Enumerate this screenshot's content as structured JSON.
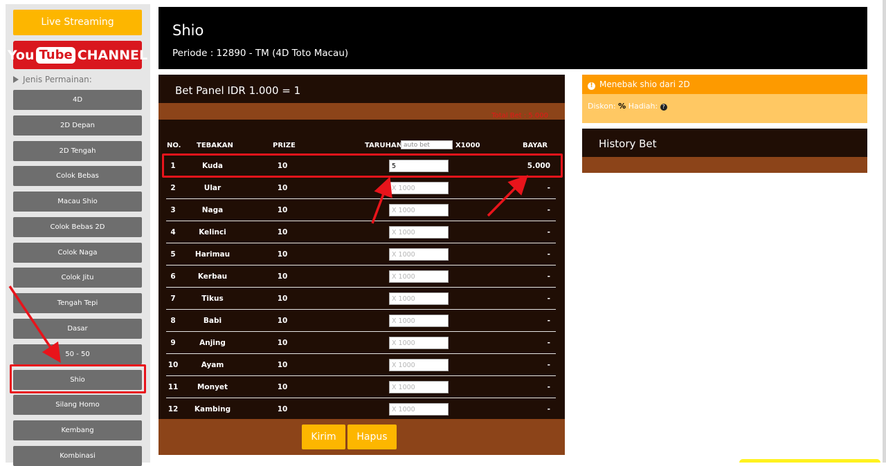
{
  "sidebar": {
    "live_label": "Live Streaming",
    "youtube_left": "You",
    "youtube_tube": "Tube",
    "youtube_channel": "CHANNEL",
    "jenis_label": "Jenis Permainan:",
    "items": [
      {
        "label": "4D"
      },
      {
        "label": "2D Depan"
      },
      {
        "label": "2D Tengah"
      },
      {
        "label": "Colok Bebas"
      },
      {
        "label": "Macau Shio"
      },
      {
        "label": "Colok Bebas 2D"
      },
      {
        "label": "Colok Naga"
      },
      {
        "label": "Colok Jitu"
      },
      {
        "label": "Tengah Tepi"
      },
      {
        "label": "Dasar"
      },
      {
        "label": "50 - 50"
      },
      {
        "label": "Shio",
        "active": true
      },
      {
        "label": "Silang Homo"
      },
      {
        "label": "Kembang"
      },
      {
        "label": "Kombinasi"
      }
    ]
  },
  "header": {
    "title": "Shio",
    "periode": "Periode : 12890 - TM (4D Toto Macau)"
  },
  "bet_panel": {
    "title": "Bet Panel IDR 1.000 = 1",
    "total_bet": "Total Bet : 5.000",
    "columns": {
      "no": "NO.",
      "tebakan": "TEBAKAN",
      "prize": "PRIZE",
      "taruhan": "TARUHAN",
      "autobet_placeholder": "auto bet",
      "x1000": "X1000",
      "bayar": "BAYAR"
    },
    "input_placeholder": "X 1000",
    "rows": [
      {
        "no": "1",
        "tebakan": "Kuda",
        "prize": "10",
        "taruhan": "5",
        "bayar": "5.000"
      },
      {
        "no": "2",
        "tebakan": "Ular",
        "prize": "10",
        "taruhan": "",
        "bayar": "-"
      },
      {
        "no": "3",
        "tebakan": "Naga",
        "prize": "10",
        "taruhan": "",
        "bayar": "-"
      },
      {
        "no": "4",
        "tebakan": "Kelinci",
        "prize": "10",
        "taruhan": "",
        "bayar": "-"
      },
      {
        "no": "5",
        "tebakan": "Harimau",
        "prize": "10",
        "taruhan": "",
        "bayar": "-"
      },
      {
        "no": "6",
        "tebakan": "Kerbau",
        "prize": "10",
        "taruhan": "",
        "bayar": "-"
      },
      {
        "no": "7",
        "tebakan": "Tikus",
        "prize": "10",
        "taruhan": "",
        "bayar": "-"
      },
      {
        "no": "8",
        "tebakan": "Babi",
        "prize": "10",
        "taruhan": "",
        "bayar": "-"
      },
      {
        "no": "9",
        "tebakan": "Anjing",
        "prize": "10",
        "taruhan": "",
        "bayar": "-"
      },
      {
        "no": "10",
        "tebakan": "Ayam",
        "prize": "10",
        "taruhan": "",
        "bayar": "-"
      },
      {
        "no": "11",
        "tebakan": "Monyet",
        "prize": "10",
        "taruhan": "",
        "bayar": "-"
      },
      {
        "no": "12",
        "tebakan": "Kambing",
        "prize": "10",
        "taruhan": "",
        "bayar": "-"
      }
    ],
    "kirim_label": "Kirim",
    "hapus_label": "Hapus"
  },
  "info": {
    "title": "Menebak shio dari 2D",
    "diskon_label": "Diskon:",
    "diskon_value": "%",
    "hadiah_label": "Hadiah:",
    "hadiah_icon": "?"
  },
  "history": {
    "title": "History Bet"
  },
  "colors": {
    "accent_yellow": "#fdb600",
    "dark_brown": "#200e05",
    "band_brown": "#8c4419",
    "annotation_red": "#e8141b"
  }
}
